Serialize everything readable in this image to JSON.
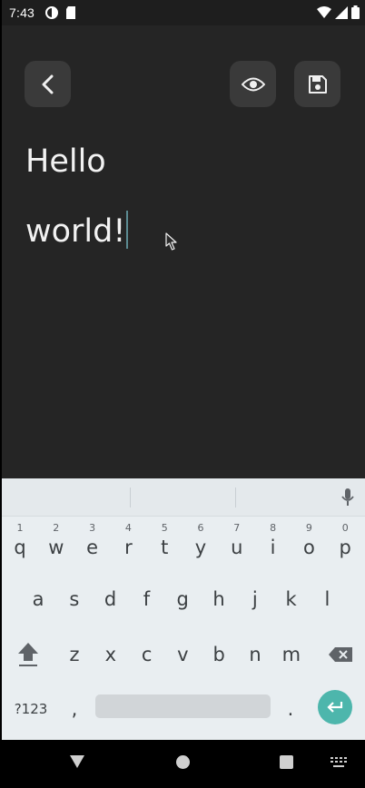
{
  "status_bar": {
    "time": "7:43"
  },
  "toolbar": {
    "back_icon": "chevron-left-icon",
    "preview_icon": "eye-icon",
    "save_icon": "floppy-disk-icon"
  },
  "editor": {
    "lines": [
      "Hello",
      "world!"
    ]
  },
  "keyboard": {
    "row1": [
      {
        "key": "q",
        "hint": "1"
      },
      {
        "key": "w",
        "hint": "2"
      },
      {
        "key": "e",
        "hint": "3"
      },
      {
        "key": "r",
        "hint": "4"
      },
      {
        "key": "t",
        "hint": "5"
      },
      {
        "key": "y",
        "hint": "6"
      },
      {
        "key": "u",
        "hint": "7"
      },
      {
        "key": "i",
        "hint": "8"
      },
      {
        "key": "o",
        "hint": "9"
      },
      {
        "key": "p",
        "hint": "0"
      }
    ],
    "row2": [
      "a",
      "s",
      "d",
      "f",
      "g",
      "h",
      "j",
      "k",
      "l"
    ],
    "row3": [
      "z",
      "x",
      "c",
      "v",
      "b",
      "n",
      "m"
    ],
    "symbols_label": "?123",
    "comma_label": ",",
    "period_label": ".",
    "enter_color": "#4db6ac"
  },
  "colors": {
    "background": "#252525",
    "button": "#3a3a3a",
    "caret": "#5b8a91"
  }
}
